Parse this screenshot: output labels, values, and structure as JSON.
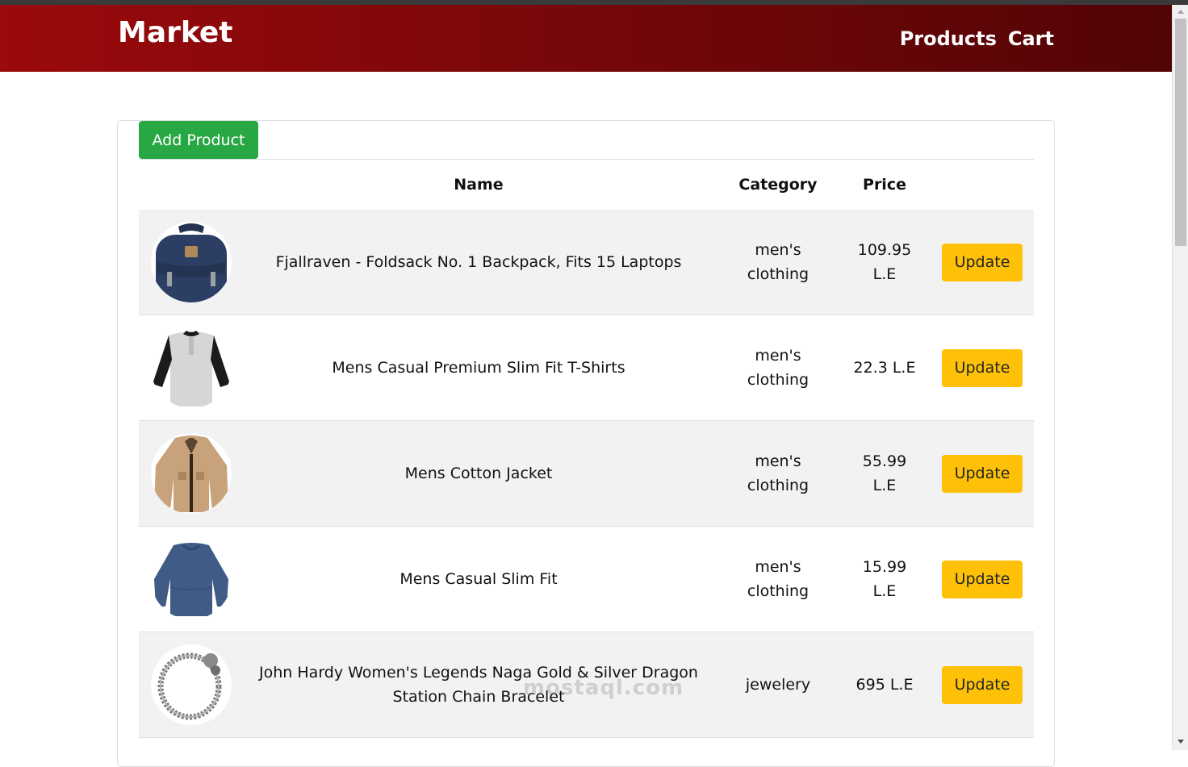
{
  "navbar": {
    "brand": "Market",
    "links": [
      "Products",
      "Cart"
    ],
    "gradient_from": "#9b0a0c",
    "gradient_to": "#520406"
  },
  "actions": {
    "add_product_label": "Add Product",
    "add_color": "#28a745"
  },
  "table": {
    "headers": {
      "name": "Name",
      "category": "Category",
      "price": "Price"
    },
    "update_color": "#ffc107",
    "rows": [
      {
        "image": "backpack-image",
        "name": "Fjallraven - Foldsack No. 1 Backpack, Fits 15 Laptops",
        "category": "men's clothing",
        "price": "109.95 L.E",
        "action": "Update"
      },
      {
        "image": "tshirt-image",
        "name": "Mens Casual Premium Slim Fit T-Shirts",
        "category": "men's clothing",
        "price": "22.3 L.E",
        "action": "Update"
      },
      {
        "image": "jacket-image",
        "name": "Mens Cotton Jacket",
        "category": "men's clothing",
        "price": "55.99 L.E",
        "action": "Update"
      },
      {
        "image": "sweater-image",
        "name": "Mens Casual Slim Fit",
        "category": "men's clothing",
        "price": "15.99 L.E",
        "action": "Update"
      },
      {
        "image": "bracelet-image",
        "name": "John Hardy Women's Legends Naga Gold & Silver Dragon Station Chain Bracelet",
        "category": "jewelery",
        "price": "695 L.E",
        "action": "Update"
      }
    ]
  },
  "watermark": "mostaql.com"
}
